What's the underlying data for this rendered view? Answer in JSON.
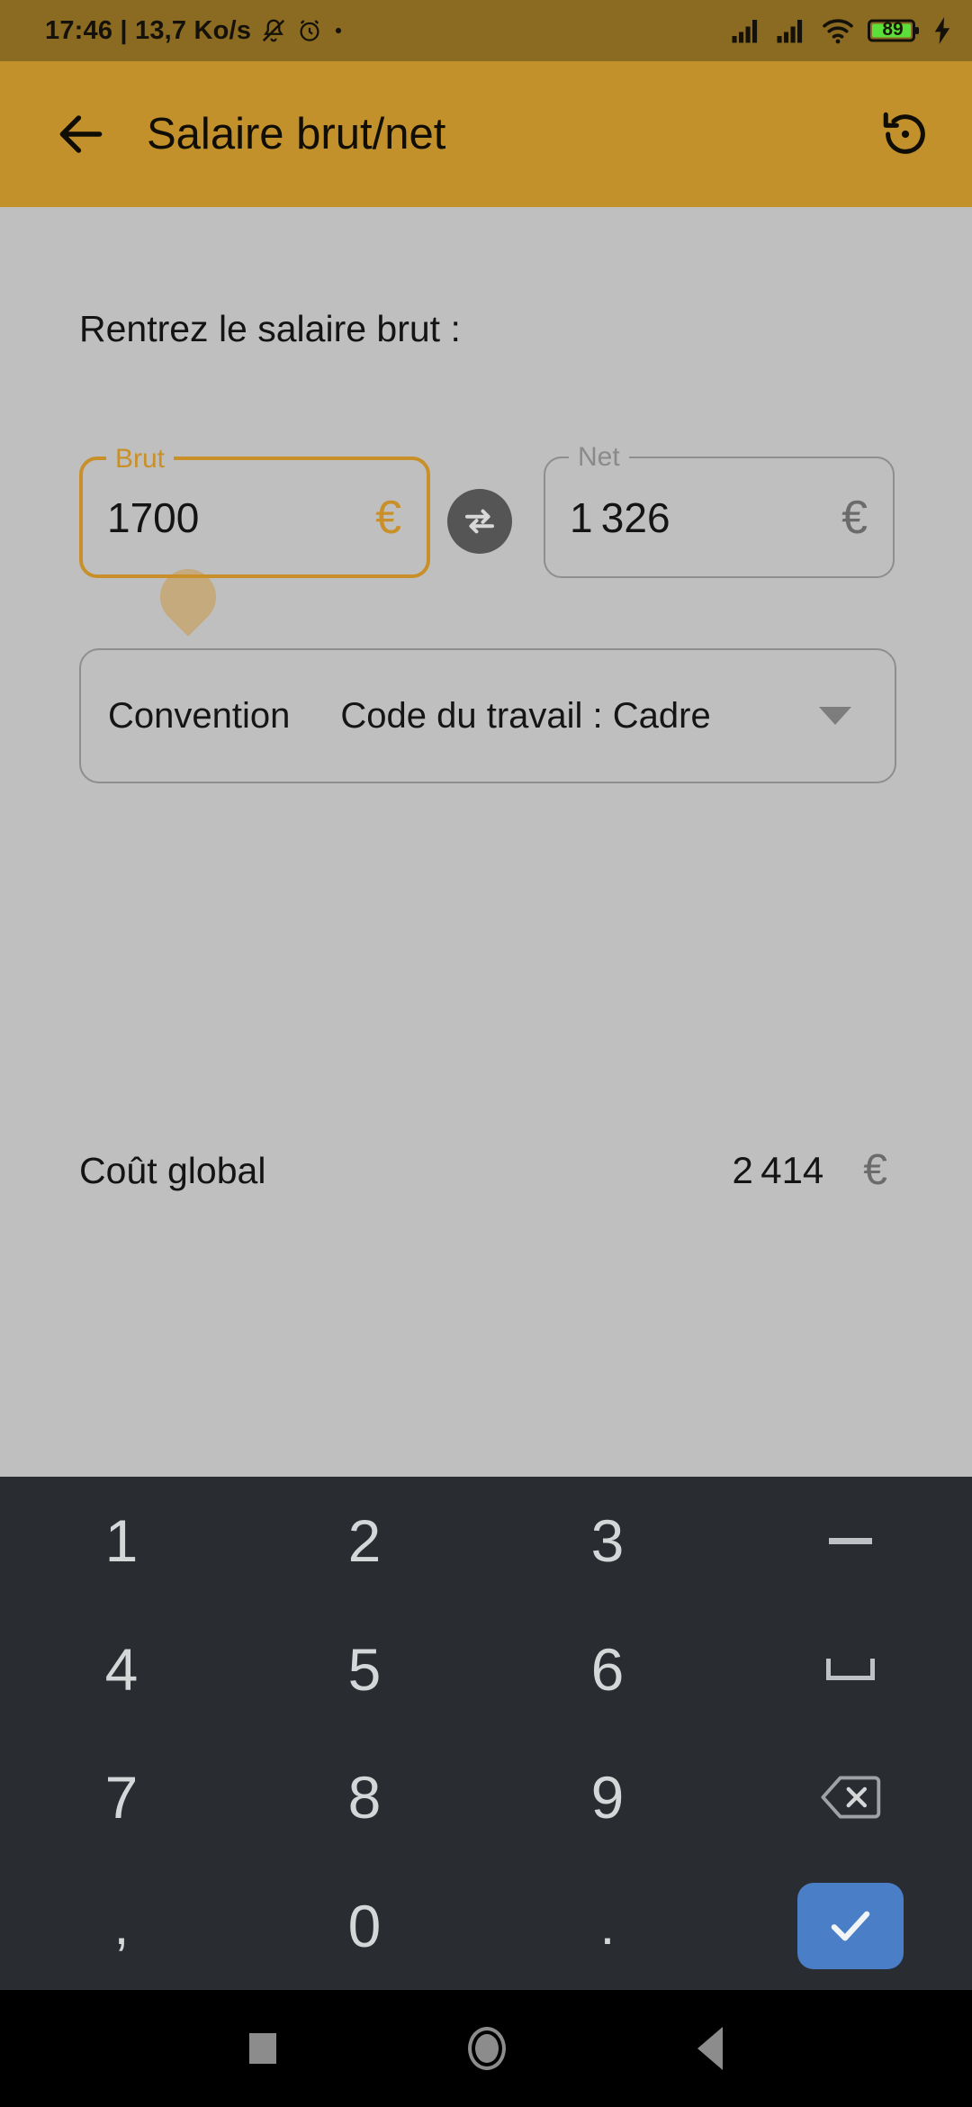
{
  "status_bar": {
    "time_and_rate": "17:46 | 13,7 Ko/s",
    "icons": [
      "mute-icon",
      "alarm-icon",
      "dot-icon",
      "signal-icon",
      "signal-icon",
      "wifi-icon"
    ],
    "battery_level": "89",
    "battery_color": "#5BE03A",
    "charging": true,
    "background": "#8B6A21"
  },
  "appbar": {
    "back_label": "back-arrow",
    "title": "Salaire brut/net",
    "reset_label": "reset-history",
    "background": "#C3912B"
  },
  "content": {
    "prompt": "Rentrez le salaire brut :",
    "background": "#BFBFBF",
    "accent": "#C9902A",
    "fields": [
      {
        "name": "brut",
        "label": "Brut",
        "value": "1700",
        "currency": "€",
        "focused": true,
        "border_color": "#C9902A"
      },
      {
        "name": "net",
        "label": "Net",
        "value": "1 326",
        "currency": "€",
        "focused": false,
        "border_color": "#8e8e8e"
      }
    ],
    "swap_button": "swap-arrows",
    "convention": {
      "label": "Convention",
      "value": "Code du travail : Cadre",
      "arrow": "chevron-down"
    },
    "cost": {
      "label": "Coût global",
      "value": "2 414",
      "currency": "€"
    }
  },
  "keyboard": {
    "background": "#292C31",
    "enter_color": "#4A7FC8",
    "keys": [
      {
        "label": "1",
        "name": "key-1",
        "type": "digit"
      },
      {
        "label": "2",
        "name": "key-2",
        "type": "digit"
      },
      {
        "label": "3",
        "name": "key-3",
        "type": "digit"
      },
      {
        "label": "−",
        "name": "key-minus",
        "type": "minus"
      },
      {
        "label": "4",
        "name": "key-4",
        "type": "digit"
      },
      {
        "label": "5",
        "name": "key-5",
        "type": "digit"
      },
      {
        "label": "6",
        "name": "key-6",
        "type": "digit"
      },
      {
        "label": "␣",
        "name": "key-space",
        "type": "space"
      },
      {
        "label": "7",
        "name": "key-7",
        "type": "digit"
      },
      {
        "label": "8",
        "name": "key-8",
        "type": "digit"
      },
      {
        "label": "9",
        "name": "key-9",
        "type": "digit"
      },
      {
        "label": "⌫",
        "name": "key-backspace",
        "type": "backspace"
      },
      {
        "label": ",",
        "name": "key-comma",
        "type": "digit"
      },
      {
        "label": "0",
        "name": "key-0",
        "type": "digit"
      },
      {
        "label": ".",
        "name": "key-period",
        "type": "digit"
      },
      {
        "label": "✓",
        "name": "key-enter",
        "type": "enter"
      }
    ]
  },
  "navbar": {
    "recents": "recents-square",
    "home": "home-circle",
    "back": "back-triangle"
  }
}
